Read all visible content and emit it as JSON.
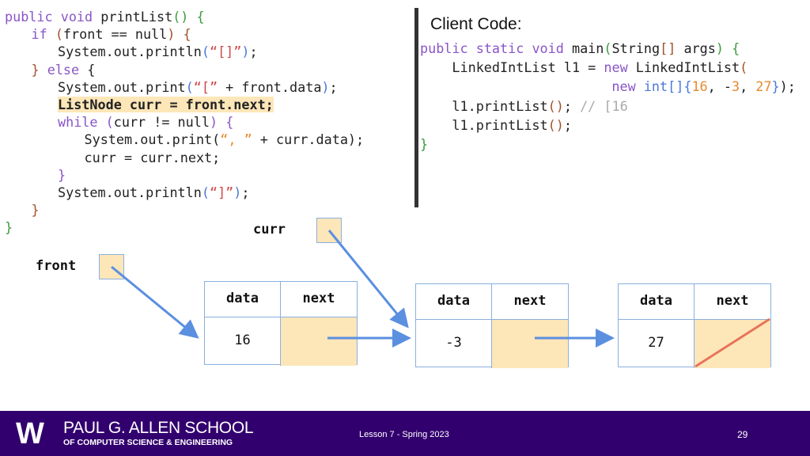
{
  "left_code": {
    "lines": [
      {
        "indent": 0,
        "tokens": [
          [
            "public void ",
            "kw"
          ],
          [
            "printList",
            "pl"
          ],
          [
            "() {",
            "gr"
          ]
        ]
      },
      {
        "indent": 1,
        "tokens": [
          [
            "if ",
            "kw"
          ],
          [
            "(",
            "br"
          ],
          [
            "front == null",
            "pl"
          ],
          [
            ") {",
            "br"
          ]
        ]
      },
      {
        "indent": 2,
        "tokens": [
          [
            "System.out.println",
            "pl"
          ],
          [
            "(",
            "bl"
          ],
          [
            "“[]”",
            "rd"
          ],
          [
            ")",
            "bl"
          ],
          [
            ";",
            "pl"
          ]
        ]
      },
      {
        "indent": 1,
        "tokens": [
          [
            "} ",
            "br"
          ],
          [
            "else ",
            "kw"
          ],
          [
            "{",
            "pl"
          ]
        ]
      },
      {
        "indent": 2,
        "tokens": [
          [
            "System.out.print",
            "pl"
          ],
          [
            "(",
            "bl"
          ],
          [
            "“[”",
            "rd"
          ],
          [
            " + front.data",
            "pl"
          ],
          [
            ")",
            "bl"
          ],
          [
            ";",
            "pl"
          ]
        ]
      },
      {
        "indent": 2,
        "highlight": true,
        "tokens": [
          [
            "ListNode curr = front.next;",
            "pl"
          ]
        ]
      },
      {
        "indent": 2,
        "tokens": [
          [
            "while ",
            "kw"
          ],
          [
            "(",
            "kw"
          ],
          [
            "curr != null",
            "pl"
          ],
          [
            ") {",
            "kw"
          ]
        ]
      },
      {
        "indent": 3,
        "tokens": [
          [
            "System.out.print(",
            "pl"
          ],
          [
            "“, ”",
            "or"
          ],
          [
            " + curr.data);",
            "pl"
          ]
        ]
      },
      {
        "indent": 3,
        "tokens": [
          [
            "curr = curr.next;",
            "pl"
          ]
        ]
      },
      {
        "indent": 2,
        "tokens": [
          [
            "}",
            "kw"
          ]
        ]
      },
      {
        "indent": 2,
        "tokens": [
          [
            "System.out.println",
            "pl"
          ],
          [
            "(",
            "bl"
          ],
          [
            "“]”",
            "rd"
          ],
          [
            ")",
            "bl"
          ],
          [
            ";",
            "pl"
          ]
        ]
      },
      {
        "indent": 1,
        "tokens": [
          [
            "}",
            "br"
          ]
        ]
      },
      {
        "indent": 0,
        "tokens": [
          [
            "}",
            "gr"
          ]
        ]
      }
    ]
  },
  "client": {
    "title": "Client Code:",
    "lines": [
      {
        "pad": 0,
        "tokens": [
          [
            "public static void ",
            "kw"
          ],
          [
            "main",
            "pl"
          ],
          [
            "(",
            "gr"
          ],
          [
            "String",
            "pl"
          ],
          [
            "[]",
            "br"
          ],
          [
            " args",
            "pl"
          ],
          [
            ") {",
            "gr"
          ]
        ]
      },
      {
        "pad": 4,
        "tokens": [
          [
            "LinkedIntList l1 = ",
            "pl"
          ],
          [
            "new ",
            "kw"
          ],
          [
            "LinkedIntList",
            "pl"
          ],
          [
            "(",
            "br"
          ]
        ]
      },
      {
        "pad": 24,
        "tokens": [
          [
            "new ",
            "kw"
          ],
          [
            "int",
            "bl"
          ],
          [
            "[]{",
            "bl"
          ],
          [
            "16",
            "or"
          ],
          [
            ", -",
            "pl"
          ],
          [
            "3",
            "or"
          ],
          [
            ", ",
            "pl"
          ],
          [
            "27",
            "or"
          ],
          [
            "}",
            "bl"
          ],
          [
            ");",
            "pl"
          ]
        ]
      },
      {
        "pad": 4,
        "tokens": [
          [
            "l1.printList",
            "pl"
          ],
          [
            "()",
            "br"
          ],
          [
            "; ",
            "pl"
          ],
          [
            "// [16",
            "cm"
          ]
        ]
      },
      {
        "pad": 4,
        "tokens": [
          [
            "l1.printList",
            "pl"
          ],
          [
            "()",
            "br"
          ],
          [
            ";",
            "pl"
          ]
        ]
      },
      {
        "pad": 0,
        "tokens": [
          [
            "}",
            "gr"
          ]
        ]
      }
    ]
  },
  "diagram": {
    "front_label": "front",
    "curr_label": "curr",
    "nodes": [
      {
        "data_header": "data",
        "next_header": "next",
        "data": "16",
        "next_null": false
      },
      {
        "data_header": "data",
        "next_header": "next",
        "data": "-3",
        "next_null": false
      },
      {
        "data_header": "data",
        "next_header": "next",
        "data": "27",
        "next_null": true
      }
    ],
    "colors": {
      "arrow": "#5b8fe0",
      "null_slash": "#e8735a",
      "cell_fill": "#fde6b8"
    }
  },
  "footer": {
    "logo_letter": "W",
    "school_line1": "PAUL G. ALLEN SCHOOL",
    "school_line2": "OF COMPUTER SCIENCE & ENGINEERING",
    "lesson": "Lesson 7 - Spring 2023",
    "page": "29",
    "background": "#32006e"
  }
}
